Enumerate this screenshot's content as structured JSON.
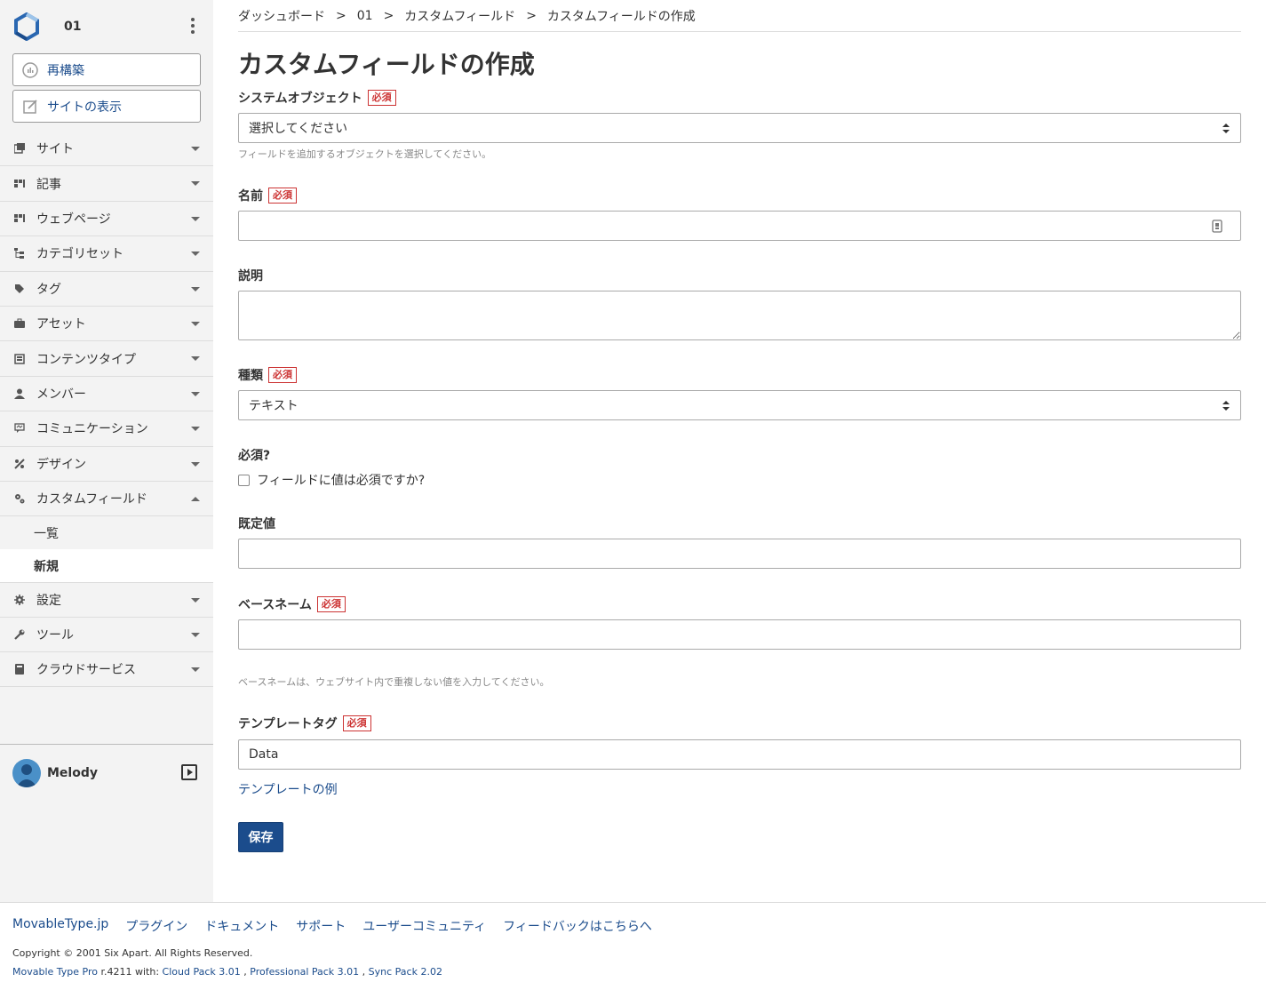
{
  "site": {
    "name": "01"
  },
  "sidebar": {
    "buttons": [
      {
        "label": "再構築",
        "icon": "rebuild-icon"
      },
      {
        "label": "サイトの表示",
        "icon": "view-site-icon"
      }
    ],
    "menu": [
      {
        "label": "サイト",
        "icon": "site-icon"
      },
      {
        "label": "記事",
        "icon": "entry-icon"
      },
      {
        "label": "ウェブページ",
        "icon": "page-icon"
      },
      {
        "label": "カテゴリセット",
        "icon": "category-icon"
      },
      {
        "label": "タグ",
        "icon": "tag-icon"
      },
      {
        "label": "アセット",
        "icon": "asset-icon"
      },
      {
        "label": "コンテンツタイプ",
        "icon": "content-type-icon"
      },
      {
        "label": "メンバー",
        "icon": "member-icon"
      },
      {
        "label": "コミュニケーション",
        "icon": "comment-icon"
      },
      {
        "label": "デザイン",
        "icon": "design-icon"
      },
      {
        "label": "カスタムフィールド",
        "icon": "custom-field-icon"
      },
      {
        "label": "設定",
        "icon": "gear-icon"
      },
      {
        "label": "ツール",
        "icon": "wrench-icon"
      },
      {
        "label": "クラウドサービス",
        "icon": "cloud-service-icon"
      }
    ],
    "submenu": [
      {
        "label": "一覧"
      },
      {
        "label": "新規"
      }
    ],
    "user": {
      "name": "Melody"
    }
  },
  "breadcrumb": [
    "ダッシュボード",
    "01",
    "カスタムフィールド",
    "カスタムフィールドの作成"
  ],
  "breadcrumb_sep": ">",
  "page": {
    "title": "カスタムフィールドの作成"
  },
  "required_badge": "必須",
  "form": {
    "system_object": {
      "label": "システムオブジェクト",
      "value": "選択してください",
      "hint": "フィールドを追加するオブジェクトを選択してください。"
    },
    "name": {
      "label": "名前",
      "value": ""
    },
    "description": {
      "label": "説明",
      "value": ""
    },
    "type": {
      "label": "種類",
      "value": "テキスト"
    },
    "required": {
      "label": "必須?",
      "checkbox_label": "フィールドに値は必須ですか?",
      "checked": false
    },
    "default": {
      "label": "既定値",
      "value": ""
    },
    "basename": {
      "label": "ベースネーム",
      "value": "",
      "hint": "ベースネームは、ウェブサイト内で重複しない値を入力してください。"
    },
    "template_tag": {
      "label": "テンプレートタグ",
      "value": "Data",
      "example_link": "テンプレートの例"
    },
    "save_label": "保存"
  },
  "footer": {
    "links": [
      "MovableType.jp",
      "プラグイン",
      "ドキュメント",
      "サポート",
      "ユーザーコミュニティ",
      "フィードバックはこちらへ"
    ],
    "copyright": "Copyright © 2001 Six Apart. All Rights Reserved.",
    "version_prefix": "Movable Type Pro",
    "version_mid": " r.4211 with: ",
    "packs": [
      "Cloud Pack 3.01",
      "Professional Pack 3.01",
      "Sync Pack 2.02"
    ]
  },
  "colors": {
    "accent": "#1b4c8c",
    "required": "#cc3333",
    "sidebar_bg": "#f3f3f3"
  }
}
